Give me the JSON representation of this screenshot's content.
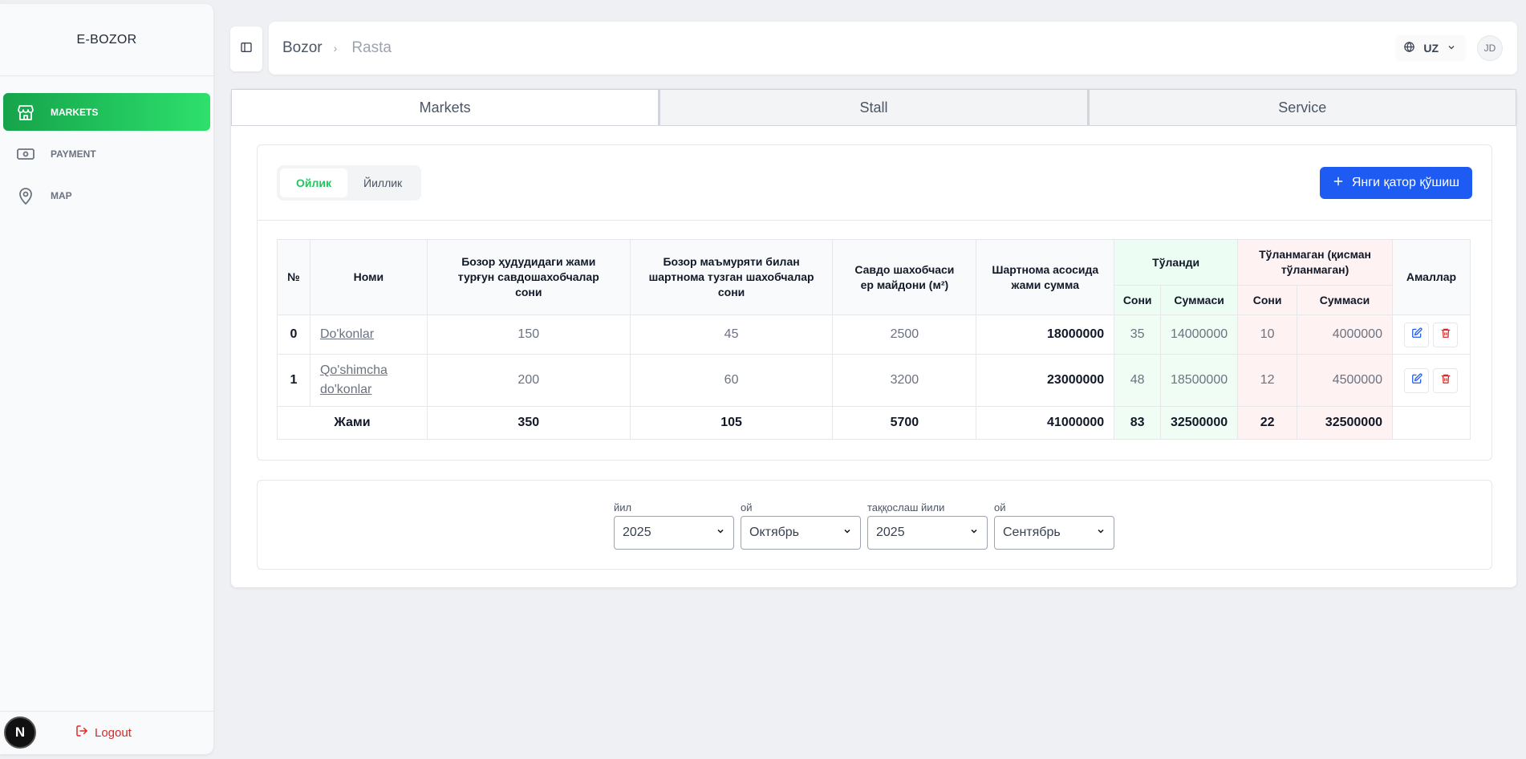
{
  "sidebar": {
    "brand": "E-BOZOR",
    "items": [
      {
        "label": "MARKETS",
        "icon": "store-icon",
        "active": true
      },
      {
        "label": "PAYMENT",
        "icon": "banknote-icon"
      },
      {
        "label": "MAP",
        "icon": "map-pin-icon"
      }
    ],
    "logout": "Logout",
    "badge": "N"
  },
  "header": {
    "breadcrumb": [
      "Bozor",
      "Rasta"
    ],
    "lang": "UZ",
    "avatar": "JD"
  },
  "tabs": [
    "Markets",
    "Stall",
    "Service"
  ],
  "period": {
    "monthly": "Ойлик",
    "yearly": "Йиллик"
  },
  "add_button": "Янги қатор қўшиш",
  "table": {
    "headers": {
      "no": "№",
      "name": "Номи",
      "total_sellers": "Бозор ҳудудидаги жами турғун савдошахобчалар сони",
      "contract_sellers": "Бозор маъмуряти билан шартнома тузган шахобчалар сони",
      "area": "Савдо шахобчаси ер майдони (м²)",
      "contract_sum": "Шартнома асосида жами сумма",
      "paid": "Тўланди",
      "unpaid": "Тўланмаган (қисман тўланмаган)",
      "actions": "Амаллар",
      "count": "Сони",
      "amount": "Суммаси"
    },
    "rows": [
      {
        "no": "0",
        "name": "Do'konlar",
        "total": "150",
        "contract": "45",
        "area": "2500",
        "sum": "18000000",
        "paid_count": "35",
        "paid_amount": "14000000",
        "unpaid_count": "10",
        "unpaid_amount": "4000000"
      },
      {
        "no": "1",
        "name": "Qo'shimcha do'konlar",
        "total": "200",
        "contract": "60",
        "area": "3200",
        "sum": "23000000",
        "paid_count": "48",
        "paid_amount": "18500000",
        "unpaid_count": "12",
        "unpaid_amount": "4500000"
      }
    ],
    "totals": {
      "label": "Жами",
      "total": "350",
      "contract": "105",
      "area": "5700",
      "sum": "41000000",
      "paid_count": "83",
      "paid_amount": "32500000",
      "unpaid_count": "22",
      "unpaid_amount": "32500000"
    }
  },
  "filters": [
    {
      "label": "йил",
      "value": "2025"
    },
    {
      "label": "ой",
      "value": "Октябрь"
    },
    {
      "label": "таққослаш йили",
      "value": "2025"
    },
    {
      "label": "ой",
      "value": "Сентябрь"
    }
  ],
  "colors": {
    "accent_green": "#22c55e",
    "primary_blue": "#1d5bf2",
    "danger": "#dc2626"
  }
}
